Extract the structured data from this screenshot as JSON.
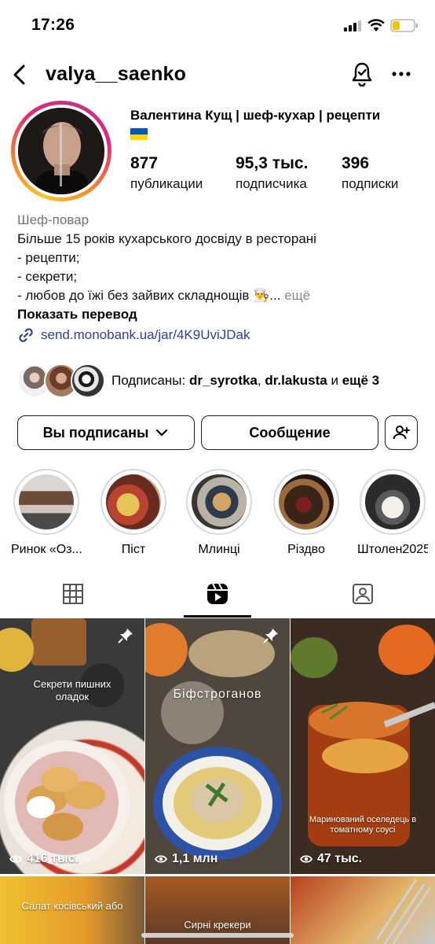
{
  "status": {
    "time": "17:26"
  },
  "header": {
    "username": "valya__saenko"
  },
  "profile": {
    "full_name": "Валентина Кущ | шеф-кухар | рецепти",
    "stats": [
      {
        "value": "877",
        "label": "публикации"
      },
      {
        "value": "95,3 тыс.",
        "label": "подписчика"
      },
      {
        "value": "396",
        "label": "подписки"
      }
    ],
    "bio": {
      "category": "Шеф-повар",
      "lines": [
        "Більше 15 років кухарського досвіду в ресторані",
        "- рецепти;",
        "- секрети;",
        "- любов до їжі без зайвих складнощів 👨‍🍳..."
      ],
      "more": "ещё",
      "translate": "Показать перевод",
      "link": "send.monobank.ua/jar/4K9UviJDak"
    },
    "followed_by": {
      "prefix": "Подписаны:",
      "user1": "dr_syrotka",
      "sep": ",",
      "user2": "dr.lakusta",
      "and": "и",
      "rest": "ещё 3"
    }
  },
  "buttons": {
    "following": "Вы подписаны",
    "message": "Сообщение"
  },
  "highlights": [
    {
      "label": "Ринок «Оз..."
    },
    {
      "label": "Піст"
    },
    {
      "label": "Млинці"
    },
    {
      "label": "Різдво"
    },
    {
      "label": "Штолен2025"
    }
  ],
  "posts": [
    {
      "title": "Секрети пишних оладок",
      "views": "416 тыс."
    },
    {
      "title": "Біфстроганов",
      "views": "1,1 млн"
    },
    {
      "title": "Маринований оселедець в томатному соусі",
      "views": "47 тыс."
    },
    {
      "title": "Салат косівський або"
    },
    {
      "title": "Сирні крекери"
    },
    {
      "title": ""
    }
  ],
  "colors": {
    "link": "#2f3da1",
    "secondary_text": "#737373",
    "flag_blue": "#0057b7",
    "flag_yellow": "#ffd700"
  }
}
